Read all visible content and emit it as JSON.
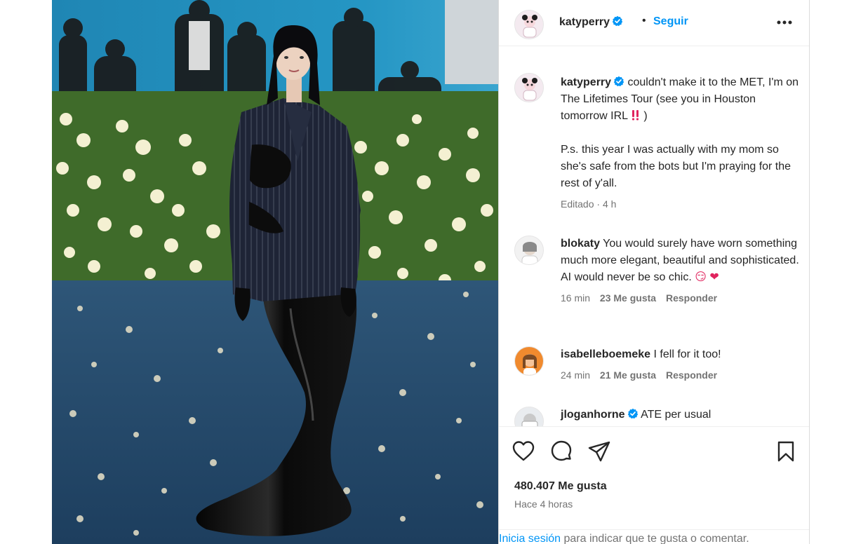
{
  "post": {
    "username": "katyperry",
    "follow_label": "Seguir",
    "caption": {
      "text_line1": "couldn't make it to the MET, I'm on The Lifetimes Tour (see you in Houston tomorrow IRL",
      "text_line1_end": ")",
      "text_line2": "P.s. this year I was actually with my mom so she's safe from the bots but I'm praying for the rest of y'all.",
      "meta_edited": "Editado",
      "meta_sep": " · ",
      "meta_time": "4 h"
    },
    "comments": [
      {
        "username": "blokaty",
        "text": "You would surely have worn something much more elegant, beautiful and sophisticated. AI would never be so chic.",
        "emoji": "😏 ❤",
        "time": "16 min",
        "likes": "23 Me gusta",
        "reply": "Responder"
      },
      {
        "username": "isabelleboemeke",
        "text": "I fell for it too!",
        "time": "24 min",
        "likes": "21 Me gusta",
        "reply": "Responder"
      },
      {
        "username": "jloganhorne",
        "text": "ATE per usual"
      }
    ],
    "likes_count": "480.407 Me gusta",
    "posted_ago": "Hace 4 horas",
    "login_prompt": {
      "link": "Inicia sesión",
      "text": " para indicar que te gusta o comentar."
    }
  },
  "icons": {
    "verified": "verified-badge-icon",
    "more": "more-options-icon",
    "like": "heart-icon",
    "comment": "comment-bubble-icon",
    "share": "paper-plane-icon",
    "save": "bookmark-icon",
    "next": "chevron-right-icon",
    "double_exclamation": "double-exclamation-icon"
  },
  "colors": {
    "accent": "#0095f6",
    "verified": "#0095f6",
    "text": "#262626",
    "muted": "#737373",
    "double_exclamation": "#e0245e"
  }
}
